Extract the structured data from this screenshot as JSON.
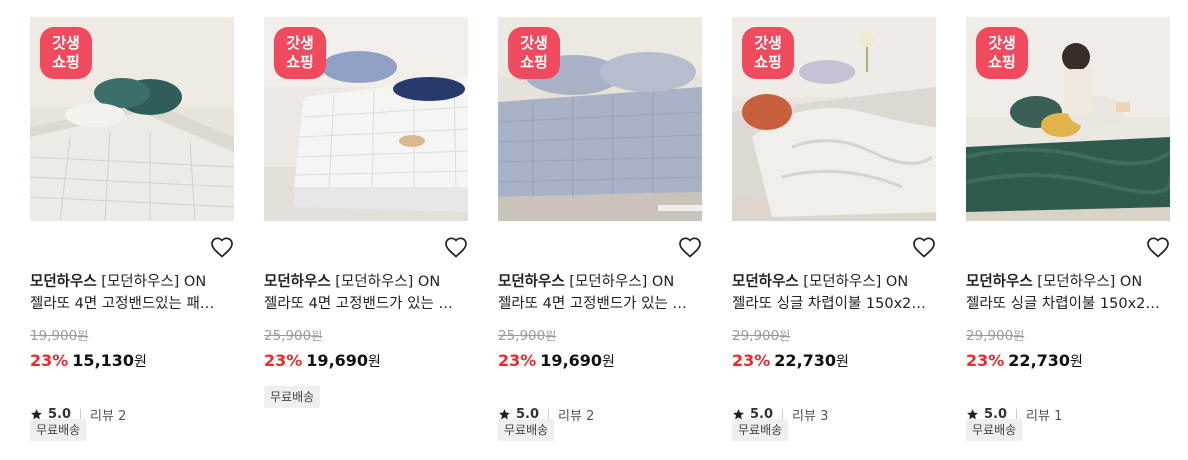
{
  "products": [
    {
      "badge": [
        "갓생",
        "쇼핑"
      ],
      "brand": "모던하우스",
      "name_line1": " [모던하우스] ON",
      "name_line2": "젤라또 4면 고정밴드있는 패…",
      "original_price": "19,900",
      "won": "원",
      "discount": "23%",
      "price": "15,130",
      "rating": "5.0",
      "review": "리뷰 2",
      "tag": "무료배송"
    },
    {
      "badge": [
        "갓생",
        "쇼핑"
      ],
      "brand": "모던하우스",
      "name_line1": " [모던하우스] ON",
      "name_line2": "젤라또 4면 고정밴드가 있는 …",
      "original_price": "25,900",
      "won": "원",
      "discount": "23%",
      "price": "19,690",
      "rating": null,
      "review": null,
      "tag": "무료배송"
    },
    {
      "badge": [
        "갓생",
        "쇼핑"
      ],
      "brand": "모던하우스",
      "name_line1": " [모던하우스] ON",
      "name_line2": "젤라또 4면 고정밴드가 있는 …",
      "original_price": "25,900",
      "won": "원",
      "discount": "23%",
      "price": "19,690",
      "rating": "5.0",
      "review": "리뷰 2",
      "tag": "무료배송"
    },
    {
      "badge": [
        "갓생",
        "쇼핑"
      ],
      "brand": "모던하우스",
      "name_line1": " [모던하우스] ON",
      "name_line2": "젤라또 싱글 차렵이불 150x2…",
      "original_price": "29,900",
      "won": "원",
      "discount": "23%",
      "price": "22,730",
      "rating": "5.0",
      "review": "리뷰 3",
      "tag": "무료배송"
    },
    {
      "badge": [
        "갓생",
        "쇼핑"
      ],
      "brand": "모던하우스",
      "name_line1": " [모던하우스] ON",
      "name_line2": "젤라또 싱글 차렵이불 150x2…",
      "original_price": "29,900",
      "won": "원",
      "discount": "23%",
      "price": "22,730",
      "rating": "5.0",
      "review": "리뷰 1",
      "tag": "무료배송"
    }
  ],
  "colors": {
    "badge": "#ef4a5d",
    "discount": "#e52d2d",
    "tag_bg": "#efefef"
  },
  "icons": {
    "wishlist": "heart-outline-icon",
    "rating": "star-icon"
  }
}
